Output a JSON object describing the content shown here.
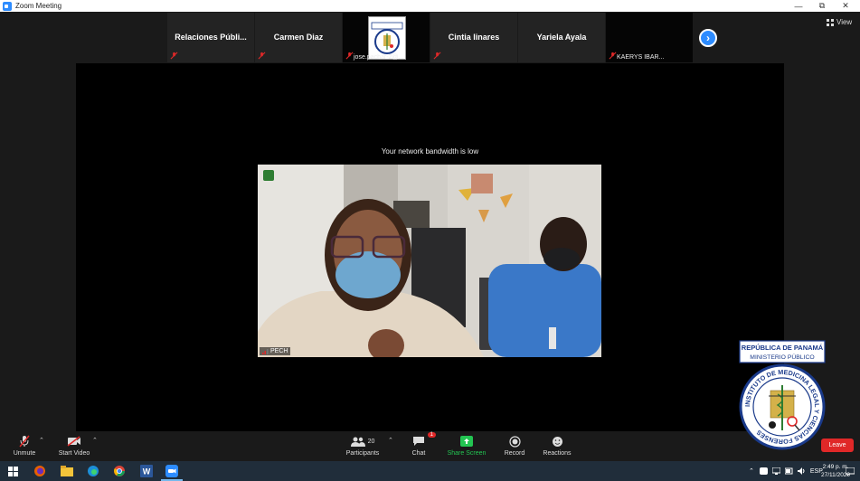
{
  "window": {
    "title": "Zoom Meeting"
  },
  "gallery": {
    "tiles": [
      {
        "name": "Relaciones  Públi..."
      },
      {
        "name": "Carmen Diaz"
      },
      {
        "caption": "jose.pachar-2@..."
      },
      {
        "name": "Cintia linares"
      },
      {
        "name": "Yariela Ayala"
      },
      {
        "caption": "KAERYS IBAR..."
      }
    ],
    "view_label": "View"
  },
  "main": {
    "notice": "Your network bandwidth is low",
    "speaker_name": "PECH"
  },
  "controls": {
    "unmute": "Unmute",
    "start_video": "Start Video",
    "participants": "Participants",
    "participants_count": "20",
    "chat": "Chat",
    "chat_badge": "1",
    "share_screen": "Share Screen",
    "record": "Record",
    "reactions": "Reactions",
    "leave": "Leave"
  },
  "emblem": {
    "line1": "REPÚBLICA DE PANAMÁ",
    "line2": "MINISTERIO PÚBLICO",
    "ring_text": "INSTITUTO DE MEDICINA LEGAL Y CIENCIAS FORENSES"
  },
  "taskbar": {
    "language": "ESP",
    "time": "2:49 p. m.",
    "date": "27/11/2020"
  },
  "colors": {
    "zoom_blue": "#2d8cff",
    "leave_red": "#e02828",
    "share_green": "#23c552"
  }
}
